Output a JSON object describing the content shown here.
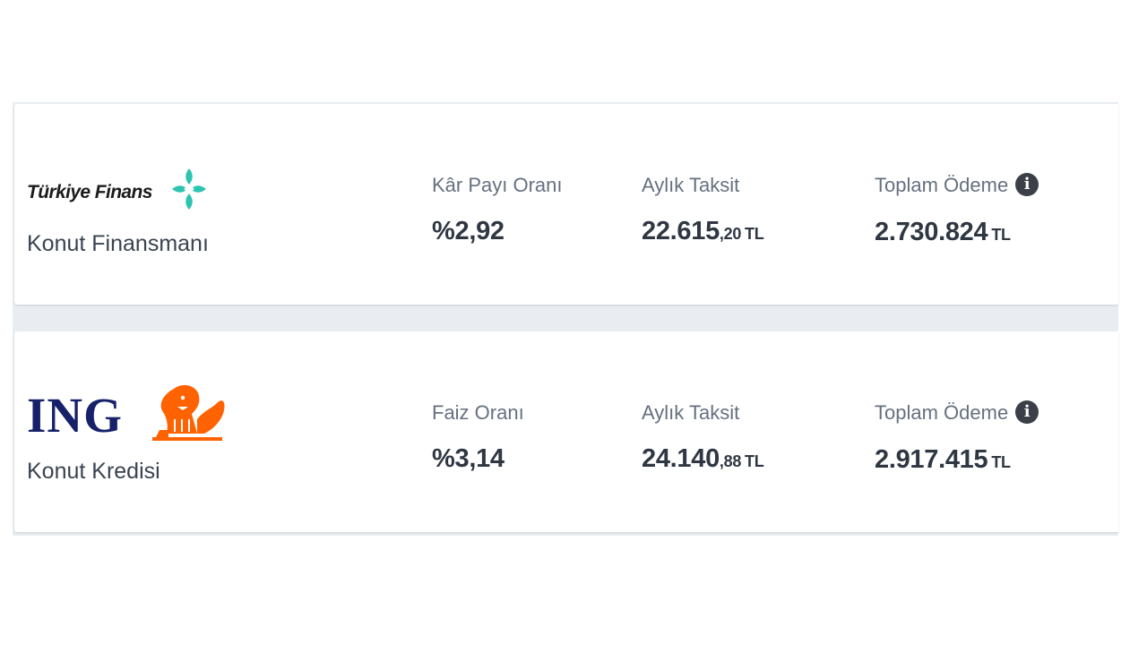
{
  "offers": [
    {
      "bank_name": "Türkiye Finans",
      "product": "Konut Finansmanı",
      "rate_label": "Kâr Payı Oranı",
      "rate_value": "%2,92",
      "monthly_label": "Aylık Taksit",
      "monthly_main": "22.615",
      "monthly_decimal": ",20",
      "monthly_currency": "TL",
      "total_label": "Toplam Ödeme",
      "total_value": "2.730.824",
      "total_currency": "TL",
      "brand_color": "#2cc4b0"
    },
    {
      "bank_name": "ING",
      "product": "Konut Kredisi",
      "rate_label": "Faiz Oranı",
      "rate_value": "%3,14",
      "monthly_label": "Aylık Taksit",
      "monthly_main": "24.140",
      "monthly_decimal": ",88",
      "monthly_currency": "TL",
      "total_label": "Toplam Ödeme",
      "total_value": "2.917.415",
      "total_currency": "TL",
      "brand_color": "#ff6200"
    }
  ],
  "icons": {
    "info": "info-icon",
    "info_glyph": "i"
  }
}
